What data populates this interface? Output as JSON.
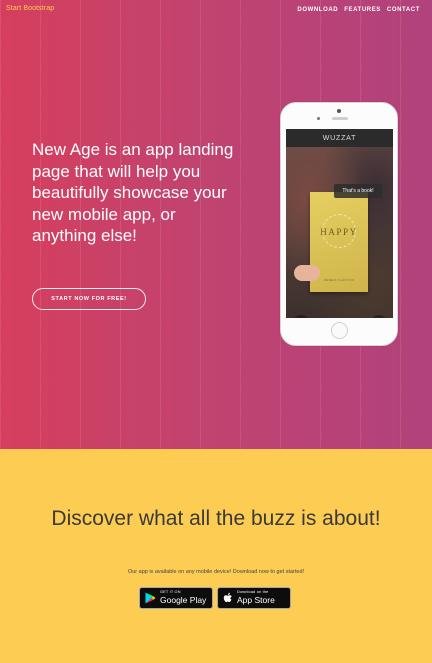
{
  "navbar": {
    "brand": "Start Bootstrap",
    "links": [
      "Download",
      "Features",
      "Contact"
    ]
  },
  "hero": {
    "headline": "New Age is an app landing page that will help you beautifully showcase your new mobile app, or anything else!",
    "cta_label": "Start Now for Free!"
  },
  "phone": {
    "app_title": "WUZZAT",
    "bubble_text": "That's a book!",
    "book_title": "HAPPY",
    "book_author": "DEREN CLAXTON",
    "icons": [
      "camera-icon",
      "search-icon"
    ]
  },
  "download": {
    "title": "Discover what all the buzz is about!",
    "subtitle": "Our app is available on any mobile device! Download now to get started!",
    "google_play": {
      "small": "GET IT ON",
      "big": "Google Play"
    },
    "app_store": {
      "small": "Download on the",
      "big": "App Store"
    }
  },
  "colors": {
    "hero_start": "#d63e5d",
    "hero_end": "#b1427d",
    "accent_yellow": "#fdcc52",
    "text_dark": "#3a3a3a"
  }
}
